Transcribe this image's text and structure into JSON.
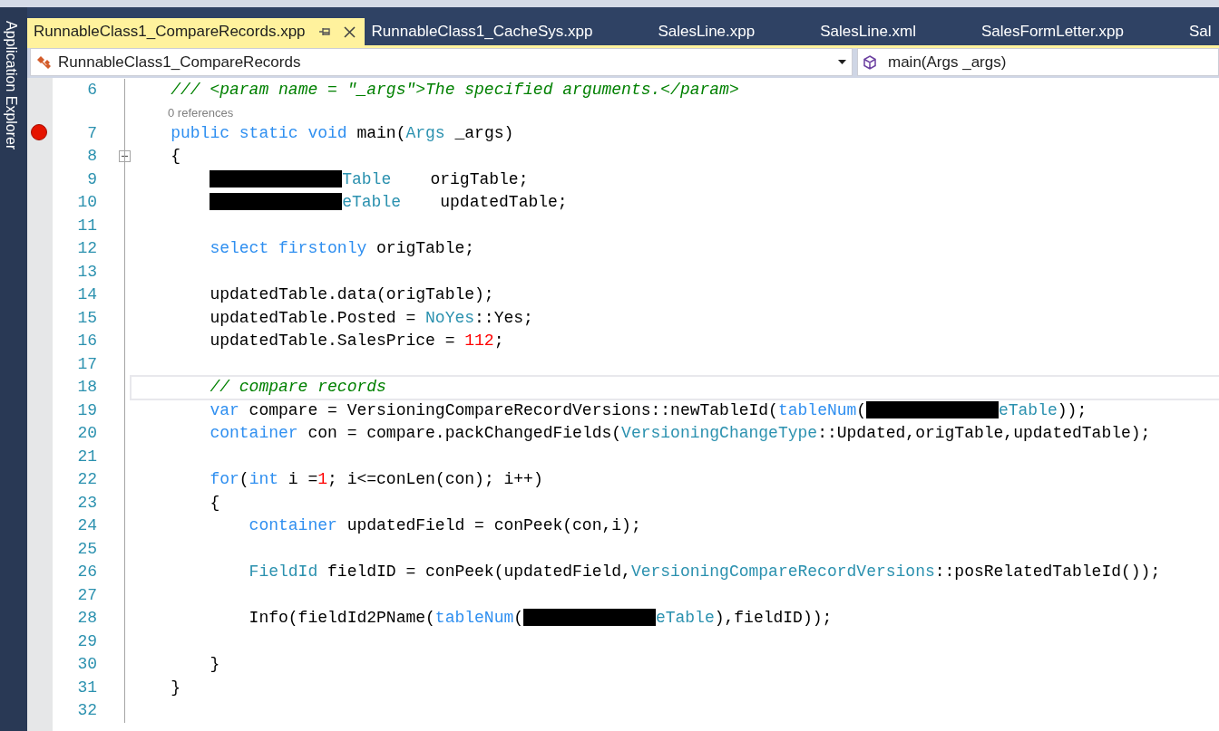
{
  "side_panel": {
    "label": "Application Explorer"
  },
  "tabs": [
    {
      "label": "RunnableClass1_CompareRecords.xpp",
      "selected": true
    },
    {
      "label": "RunnableClass1_CacheSys.xpp",
      "selected": false
    },
    {
      "label": "SalesLine.xpp",
      "selected": false
    },
    {
      "label": "SalesLine.xml",
      "selected": false
    },
    {
      "label": "SalesFormLetter.xpp",
      "selected": false
    },
    {
      "label": "Sal",
      "selected": false
    }
  ],
  "navigation_bar": {
    "type_dropdown": {
      "value": "RunnableClass1_CompareRecords"
    },
    "member_dropdown": {
      "value": "main(Args _args)"
    }
  },
  "editor": {
    "lines": [
      {
        "children": [
          {
            "number": "6",
            "tokens": [
              {
                "kind": "comment",
                "text": "/// <param name = \"_args\">The specified arguments.</param>"
              }
            ]
          },
          {
            "number": "7",
            "codelens": "0 references",
            "breakpoint": true,
            "tokens": [
              {
                "kind": "keyword",
                "text": "public static void"
              },
              {
                "kind": "plain",
                "text": " main("
              },
              {
                "kind": "type",
                "text": "Args"
              },
              {
                "kind": "plain",
                "text": " _args)"
              }
            ]
          },
          {
            "number": "8",
            "fold": {
              "expanded": true
            },
            "tokens": [
              {
                "kind": "plain",
                "text": "{"
              }
            ]
          },
          {
            "children": [
              {
                "number": "9",
                "tokens": [
                  {
                    "kind": "redacted"
                  },
                  {
                    "kind": "type",
                    "text": "Table"
                  },
                  {
                    "kind": "plain",
                    "text": "    origTable;"
                  }
                ]
              },
              {
                "number": "10",
                "tokens": [
                  {
                    "kind": "redacted"
                  },
                  {
                    "kind": "type",
                    "text": "eTable"
                  },
                  {
                    "kind": "plain",
                    "text": "    updatedTable;"
                  }
                ]
              },
              {
                "number": "11"
              },
              {
                "number": "12",
                "tokens": [
                  {
                    "kind": "keyword",
                    "text": "select firstonly"
                  },
                  {
                    "kind": "plain",
                    "text": " origTable;"
                  }
                ]
              },
              {
                "number": "13"
              },
              {
                "number": "14",
                "tokens": [
                  {
                    "kind": "plain",
                    "text": "updatedTable.data(origTable);"
                  }
                ]
              },
              {
                "number": "15",
                "tokens": [
                  {
                    "kind": "plain",
                    "text": "updatedTable.Posted = "
                  },
                  {
                    "kind": "type",
                    "text": "NoYes"
                  },
                  {
                    "kind": "plain",
                    "text": "::Yes;"
                  }
                ]
              },
              {
                "number": "16",
                "tokens": [
                  {
                    "kind": "plain",
                    "text": "updatedTable.SalesPrice = "
                  },
                  {
                    "kind": "number",
                    "text": "112"
                  },
                  {
                    "kind": "plain",
                    "text": ";"
                  }
                ]
              },
              {
                "number": "17"
              },
              {
                "number": "18",
                "current": true,
                "tokens": [
                  {
                    "kind": "comment",
                    "text": "// compare records"
                  }
                ]
              },
              {
                "number": "19",
                "tokens": [
                  {
                    "kind": "keyword",
                    "text": "var"
                  },
                  {
                    "kind": "plain",
                    "text": " compare = VersioningCompareRecordVersions::newTableId("
                  },
                  {
                    "kind": "keyword",
                    "text": "tableNum"
                  },
                  {
                    "kind": "plain",
                    "text": "("
                  },
                  {
                    "kind": "redacted"
                  },
                  {
                    "kind": "type",
                    "text": "eTable"
                  },
                  {
                    "kind": "plain",
                    "text": "));"
                  }
                ]
              },
              {
                "number": "20",
                "tokens": [
                  {
                    "kind": "keyword",
                    "text": "container"
                  },
                  {
                    "kind": "plain",
                    "text": " con = compare.packChangedFields("
                  },
                  {
                    "kind": "type",
                    "text": "VersioningChangeType"
                  },
                  {
                    "kind": "plain",
                    "text": "::Updated,origTable,updatedTable);"
                  }
                ]
              },
              {
                "number": "21"
              },
              {
                "number": "22",
                "tokens": [
                  {
                    "kind": "keyword",
                    "text": "for"
                  },
                  {
                    "kind": "plain",
                    "text": "("
                  },
                  {
                    "kind": "keyword",
                    "text": "int"
                  },
                  {
                    "kind": "plain",
                    "text": " i ="
                  },
                  {
                    "kind": "number",
                    "text": "1"
                  },
                  {
                    "kind": "plain",
                    "text": "; i<=conLen(con); i++)"
                  }
                ]
              },
              {
                "number": "23",
                "tokens": [
                  {
                    "kind": "plain",
                    "text": "{"
                  }
                ]
              },
              {
                "children": [
                  {
                    "number": "24",
                    "tokens": [
                      {
                        "kind": "keyword",
                        "text": "container"
                      },
                      {
                        "kind": "plain",
                        "text": " updatedField = conPeek(con,i);"
                      }
                    ]
                  },
                  {
                    "number": "25"
                  },
                  {
                    "number": "26",
                    "tokens": [
                      {
                        "kind": "type",
                        "text": "FieldId"
                      },
                      {
                        "kind": "plain",
                        "text": " fieldID = conPeek(updatedField,"
                      },
                      {
                        "kind": "type",
                        "text": "VersioningCompareRecordVersions"
                      },
                      {
                        "kind": "plain",
                        "text": "::posRelatedTableId());"
                      }
                    ]
                  },
                  {
                    "number": "27"
                  },
                  {
                    "number": "28",
                    "tokens": [
                      {
                        "kind": "plain",
                        "text": "Info(fieldId2PName("
                      },
                      {
                        "kind": "keyword",
                        "text": "tableNum"
                      },
                      {
                        "kind": "plain",
                        "text": "("
                      },
                      {
                        "kind": "redacted"
                      },
                      {
                        "kind": "type",
                        "text": "eTable"
                      },
                      {
                        "kind": "plain",
                        "text": "),fieldID));"
                      }
                    ]
                  },
                  {
                    "number": "29"
                  }
                ]
              },
              {
                "number": "30",
                "tokens": [
                  {
                    "kind": "plain",
                    "text": "}"
                  }
                ]
              }
            ]
          },
          {
            "number": "31",
            "tokens": [
              {
                "kind": "plain",
                "text": "}"
              }
            ]
          }
        ]
      },
      {
        "number": "32"
      }
    ]
  }
}
